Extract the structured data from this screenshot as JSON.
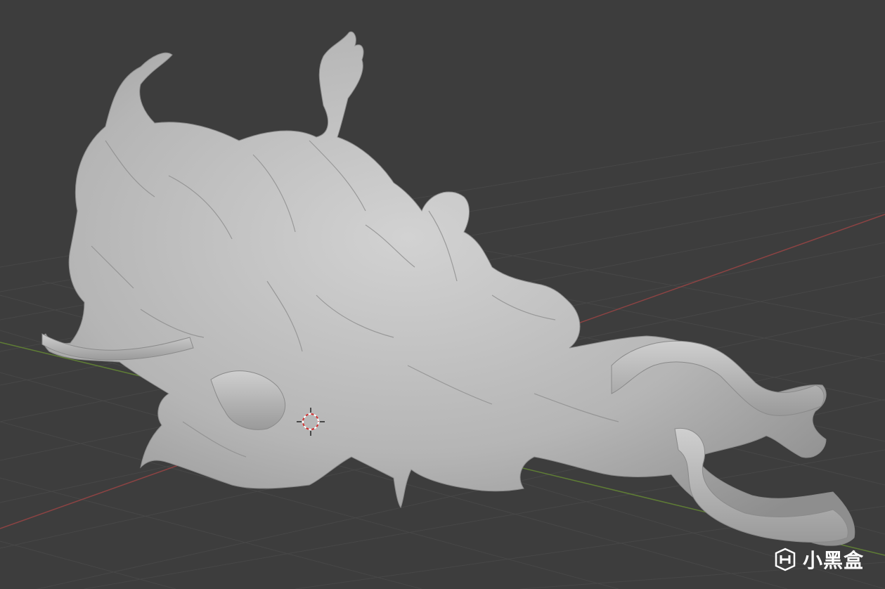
{
  "viewport": {
    "background_color": "#3d3d3d",
    "grid_color": "#4a4a4a",
    "x_axis_color": "#9a4a4a",
    "y_axis_color": "#6a8a3a",
    "model_color": "#b9b9b9",
    "cursor_icon": "3d-cursor-icon"
  },
  "watermark": {
    "text": "小黑盒",
    "icon": "heybox-logo-icon"
  }
}
